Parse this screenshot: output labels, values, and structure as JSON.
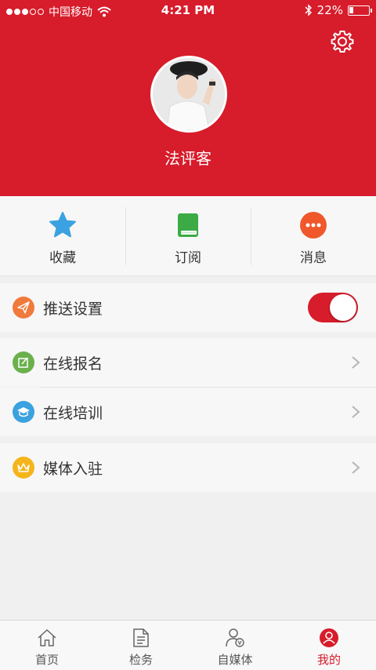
{
  "status_bar": {
    "carrier": "中国移动",
    "time": "4:21 PM",
    "battery_text": "22%",
    "battery_level": 0.22
  },
  "profile": {
    "username": "法评客"
  },
  "quick_actions": [
    {
      "label": "收藏",
      "icon": "star-icon",
      "color": "#3ba1e0"
    },
    {
      "label": "订阅",
      "icon": "book-icon",
      "color": "#3cab45"
    },
    {
      "label": "消息",
      "icon": "message-icon",
      "color": "#f0582b"
    }
  ],
  "menu": {
    "push_settings": {
      "label": "推送设置",
      "icon": "send-icon",
      "color": "#f07a3c",
      "toggle_on": true
    },
    "online_signup": {
      "label": "在线报名",
      "icon": "edit-icon",
      "color": "#6ab04c"
    },
    "online_training": {
      "label": "在线培训",
      "icon": "graduation-cap-icon",
      "color": "#3ba1e0"
    },
    "media_join": {
      "label": "媒体入驻",
      "icon": "crown-icon",
      "color": "#f4b41a"
    }
  },
  "tabbar": [
    {
      "label": "首页",
      "icon": "home-icon",
      "active": false
    },
    {
      "label": "检务",
      "icon": "document-icon",
      "active": false
    },
    {
      "label": "自媒体",
      "icon": "media-person-icon",
      "active": false
    },
    {
      "label": "我的",
      "icon": "profile-icon",
      "active": true
    }
  ],
  "colors": {
    "brand_red": "#d71c2b",
    "background": "#f0f0f0"
  }
}
